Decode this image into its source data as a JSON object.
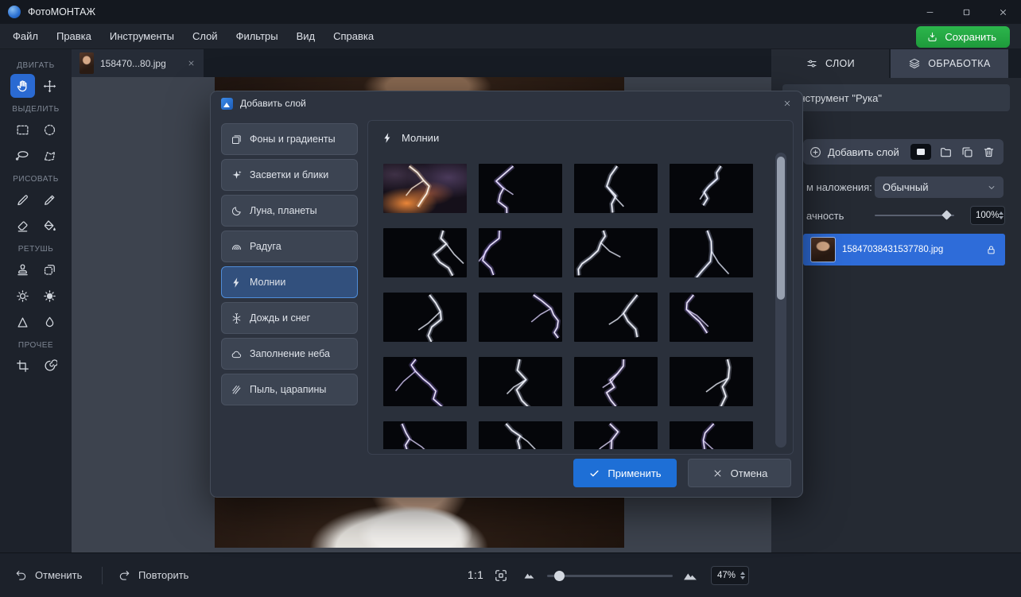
{
  "window": {
    "title": "ФотоМОНТАЖ"
  },
  "menu": {
    "items": [
      {
        "label": "Файл"
      },
      {
        "label": "Правка"
      },
      {
        "label": "Инструменты"
      },
      {
        "label": "Слой"
      },
      {
        "label": "Фильтры"
      },
      {
        "label": "Вид"
      },
      {
        "label": "Справка"
      }
    ],
    "save_label": "Сохранить"
  },
  "left_toolbar": {
    "sections": [
      {
        "label": "ДВИГАТЬ",
        "tools": [
          {
            "name": "hand-tool",
            "icon": "hand-icon",
            "active": true
          },
          {
            "name": "move-tool",
            "icon": "move-icon"
          }
        ]
      },
      {
        "label": "ВЫДЕЛИТЬ",
        "tools": [
          {
            "name": "rect-select-tool",
            "icon": "rect-select-icon"
          },
          {
            "name": "ellipse-select-tool",
            "icon": "ellipse-select-icon"
          },
          {
            "name": "lasso-tool",
            "icon": "lasso-icon"
          },
          {
            "name": "polygon-select-tool",
            "icon": "polygon-select-icon"
          }
        ]
      },
      {
        "label": "РИСОВАТЬ",
        "tools": [
          {
            "name": "brush-tool",
            "icon": "brush-icon"
          },
          {
            "name": "pencil-tool",
            "icon": "pencil-icon"
          },
          {
            "name": "eraser-tool",
            "icon": "eraser-icon"
          },
          {
            "name": "fill-tool",
            "icon": "fill-icon"
          }
        ]
      },
      {
        "label": "РЕТУШЬ",
        "tools": [
          {
            "name": "stamp-tool",
            "icon": "stamp-icon"
          },
          {
            "name": "patch-tool",
            "icon": "patch-icon"
          },
          {
            "name": "dodge-tool",
            "icon": "dodge-icon"
          },
          {
            "name": "burn-tool",
            "icon": "burn-icon"
          },
          {
            "name": "sharpen-tool",
            "icon": "sharpen-icon"
          },
          {
            "name": "blur-tool",
            "icon": "blur-icon"
          }
        ]
      },
      {
        "label": "ПРОЧЕЕ",
        "tools": [
          {
            "name": "crop-tool",
            "icon": "crop-icon"
          },
          {
            "name": "liquify-tool",
            "icon": "liquify-icon"
          }
        ]
      }
    ]
  },
  "document_tab": {
    "label": "158470...80.jpg"
  },
  "dialog": {
    "title": "Добавить слой",
    "header": "Молнии",
    "categories": [
      {
        "name": "category-backgrounds",
        "label": "Фоны и градиенты",
        "icon": "backgrounds-icon"
      },
      {
        "name": "category-flares",
        "label": "Засветки и блики",
        "icon": "sparkle-icon"
      },
      {
        "name": "category-moon",
        "label": "Луна, планеты",
        "icon": "moon-icon"
      },
      {
        "name": "category-rainbow",
        "label": "Радуга",
        "icon": "rainbow-icon"
      },
      {
        "name": "category-lightning",
        "label": "Молнии",
        "icon": "lightning-icon",
        "active": true
      },
      {
        "name": "category-rain-snow",
        "label": "Дождь и снег",
        "icon": "snow-icon"
      },
      {
        "name": "category-sky-fill",
        "label": "Заполнение неба",
        "icon": "cloud-icon"
      },
      {
        "name": "category-dust-scratches",
        "label": "Пыль, царапины",
        "icon": "scratches-icon"
      }
    ],
    "thumbnails": [
      {
        "name": "preset-storm-sky",
        "variant": "storm",
        "color": "#ffdcb4"
      },
      {
        "name": "preset-lightning-2",
        "color": "#b29cf0"
      },
      {
        "name": "preset-lightning-3",
        "color": "#dde3ff"
      },
      {
        "name": "preset-lightning-4",
        "color": "#d6deff"
      },
      {
        "name": "preset-lightning-5",
        "color": "#e2e8ff"
      },
      {
        "name": "preset-lightning-6",
        "color": "#a88ef0"
      },
      {
        "name": "preset-lightning-7",
        "color": "#dde4ff"
      },
      {
        "name": "preset-lightning-8",
        "color": "#d2dbff"
      },
      {
        "name": "preset-lightning-9",
        "color": "#e0e6ff"
      },
      {
        "name": "preset-lightning-10",
        "color": "#b09aee"
      },
      {
        "name": "preset-lightning-11",
        "color": "#dee4ff"
      },
      {
        "name": "preset-lightning-12",
        "color": "#b6a1f2"
      },
      {
        "name": "preset-lightning-13",
        "color": "#a78cf0"
      },
      {
        "name": "preset-lightning-14",
        "color": "#e2e8ff"
      },
      {
        "name": "preset-lightning-15",
        "color": "#bfaaf4"
      },
      {
        "name": "preset-lightning-16",
        "color": "#e6ebff"
      },
      {
        "name": "preset-lightning-17",
        "color": "#b39ff0"
      },
      {
        "name": "preset-lightning-18",
        "color": "#dce2ff"
      },
      {
        "name": "preset-lightning-19",
        "color": "#c2aff6"
      },
      {
        "name": "preset-lightning-20",
        "color": "#a990ea"
      }
    ],
    "apply_label": "Применить",
    "cancel_label": "Отмена"
  },
  "right_panel": {
    "tabs": [
      {
        "label": "СЛОИ",
        "active": true
      },
      {
        "label": "ОБРАБОТКА",
        "active": false
      }
    ],
    "tool_info": "Инструмент \"Рука\"",
    "add_layer_label": "Добавить слой",
    "blend_label": "м наложения:",
    "blend_value": "Обычный",
    "opacity_label": "ачность",
    "opacity_value": "100%",
    "layers": [
      {
        "name": "15847038431537780.jpg",
        "selected": true
      }
    ]
  },
  "bottom_bar": {
    "undo": "Отменить",
    "redo": "Повторить",
    "zoom_ratio": "1:1",
    "zoom_percent": "47%"
  },
  "colors": {
    "accent_blue": "#2168d2",
    "save_green": "#23a53f",
    "selection_blue": "#2e6cd9"
  }
}
